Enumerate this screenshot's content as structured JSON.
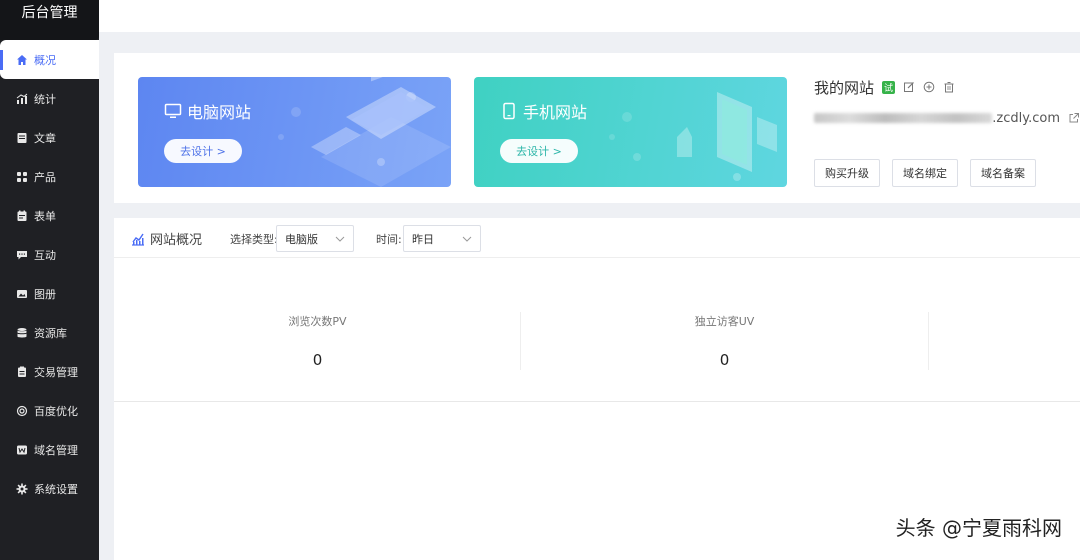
{
  "sidebar": {
    "brand": "后台管理",
    "items": [
      {
        "label": "概况",
        "icon": "home-icon",
        "active": true
      },
      {
        "label": "统计",
        "icon": "chart-icon"
      },
      {
        "label": "文章",
        "icon": "article-icon"
      },
      {
        "label": "产品",
        "icon": "grid-icon"
      },
      {
        "label": "表单",
        "icon": "form-icon"
      },
      {
        "label": "互动",
        "icon": "chat-icon"
      },
      {
        "label": "图册",
        "icon": "album-icon"
      },
      {
        "label": "资源库",
        "icon": "database-icon"
      },
      {
        "label": "交易管理",
        "icon": "clipboard-icon"
      },
      {
        "label": "百度优化",
        "icon": "seo-icon"
      },
      {
        "label": "域名管理",
        "icon": "domain-icon"
      },
      {
        "label": "系统设置",
        "icon": "gear-icon"
      }
    ]
  },
  "cards": {
    "pc": {
      "title": "电脑网站",
      "button": "去设计 >"
    },
    "mobile": {
      "title": "手机网站",
      "button": "去设计 >"
    }
  },
  "site": {
    "name": "我的网站",
    "badge": "试",
    "url_domain": ".zcdly.com",
    "actions": [
      "购买升级",
      "域名绑定",
      "域名备案"
    ]
  },
  "overview": {
    "title": "网站概况",
    "type_label": "选择类型:",
    "type_value": "电脑版",
    "time_label": "时间:",
    "time_value": "昨日",
    "stats": [
      {
        "label": "浏览次数PV",
        "value": "0"
      },
      {
        "label": "独立访客UV",
        "value": "0"
      }
    ]
  },
  "watermark": "头条 @宁夏雨科网",
  "colors": {
    "accent": "#4a6cf5",
    "sidebar_bg": "#1f2024",
    "pc_card": "#6b93f4",
    "mobile_card": "#4fd4d0",
    "trial_badge": "#37b34a"
  }
}
